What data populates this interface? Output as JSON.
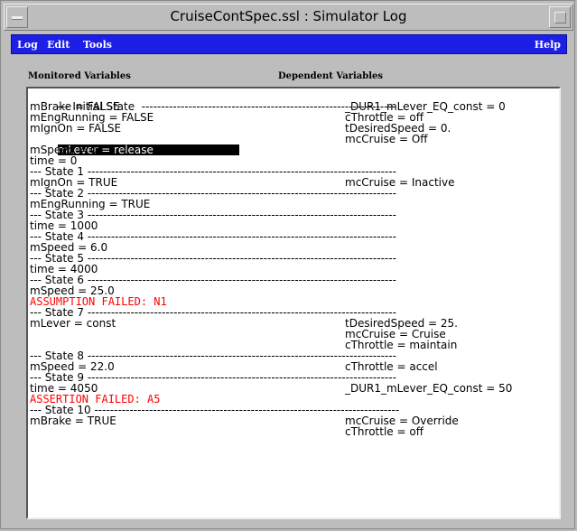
{
  "window": {
    "title": "CruiseContSpec.ssl : Simulator Log"
  },
  "menu": {
    "log": "Log",
    "edit": "Edit",
    "tools": "Tools",
    "help": "Help"
  },
  "headers": {
    "monitored": "Monitored Variables",
    "dependent": "Dependent Variables"
  },
  "log": {
    "initial_sep_left": "--- Initial State  -------------------------",
    "initial_sep_right": "----------------------------------------",
    "lines": [
      {
        "left": "mBrake = FALSE",
        "right": "_DUR1_mLever_EQ_const = 0"
      },
      {
        "left": "mEngRunning = FALSE",
        "right": "cThrottle = off"
      },
      {
        "left": "mIgnOn = FALSE",
        "right": "tDesiredSpeed = 0."
      },
      {
        "left": "mLever = release",
        "right": "mcCruise = Off"
      },
      {
        "left": "mSpeed = 0.",
        "right": ""
      },
      {
        "left": "time = 0",
        "right": ""
      }
    ],
    "state1": "--- State 1 -------------------------------------------------------------------------------",
    "s1_left": "mIgnOn = TRUE",
    "s1_right": "mcCruise = Inactive",
    "state2": "--- State 2 -------------------------------------------------------------------------------",
    "s2_left": "mEngRunning = TRUE",
    "state3": "--- State 3 -------------------------------------------------------------------------------",
    "s3_left": "time = 1000",
    "state4": "--- State 4 -------------------------------------------------------------------------------",
    "s4_left": "mSpeed = 6.0",
    "state5": "--- State 5 -------------------------------------------------------------------------------",
    "s5_left": "time = 4000",
    "state6": "--- State 6 -------------------------------------------------------------------------------",
    "s6_left": "mSpeed = 25.0",
    "s6_fail": "ASSUMPTION FAILED: N1",
    "state7": "--- State 7 -------------------------------------------------------------------------------",
    "s7_left": "mLever = const",
    "s7_right1": "tDesiredSpeed = 25.",
    "s7_right2": "mcCruise = Cruise",
    "s7_right3": "cThrottle = maintain",
    "state8": "--- State 8 -------------------------------------------------------------------------------",
    "s8_left": "mSpeed = 22.0",
    "s8_right": "cThrottle = accel",
    "state9": "--- State 9 -------------------------------------------------------------------------------",
    "s9_left": "time = 4050",
    "s9_right": "_DUR1_mLever_EQ_const = 50",
    "s9_fail": "ASSERTION FAILED: A5",
    "state10": "--- State 10 ------------------------------------------------------------------------------",
    "s10_left": "mBrake = TRUE",
    "s10_right1": "mcCruise = Override",
    "s10_right2": "cThrottle = off"
  },
  "colors": {
    "menubar": "#1d1ee6",
    "failure_text": "#ff0000",
    "selection": "#000000"
  }
}
